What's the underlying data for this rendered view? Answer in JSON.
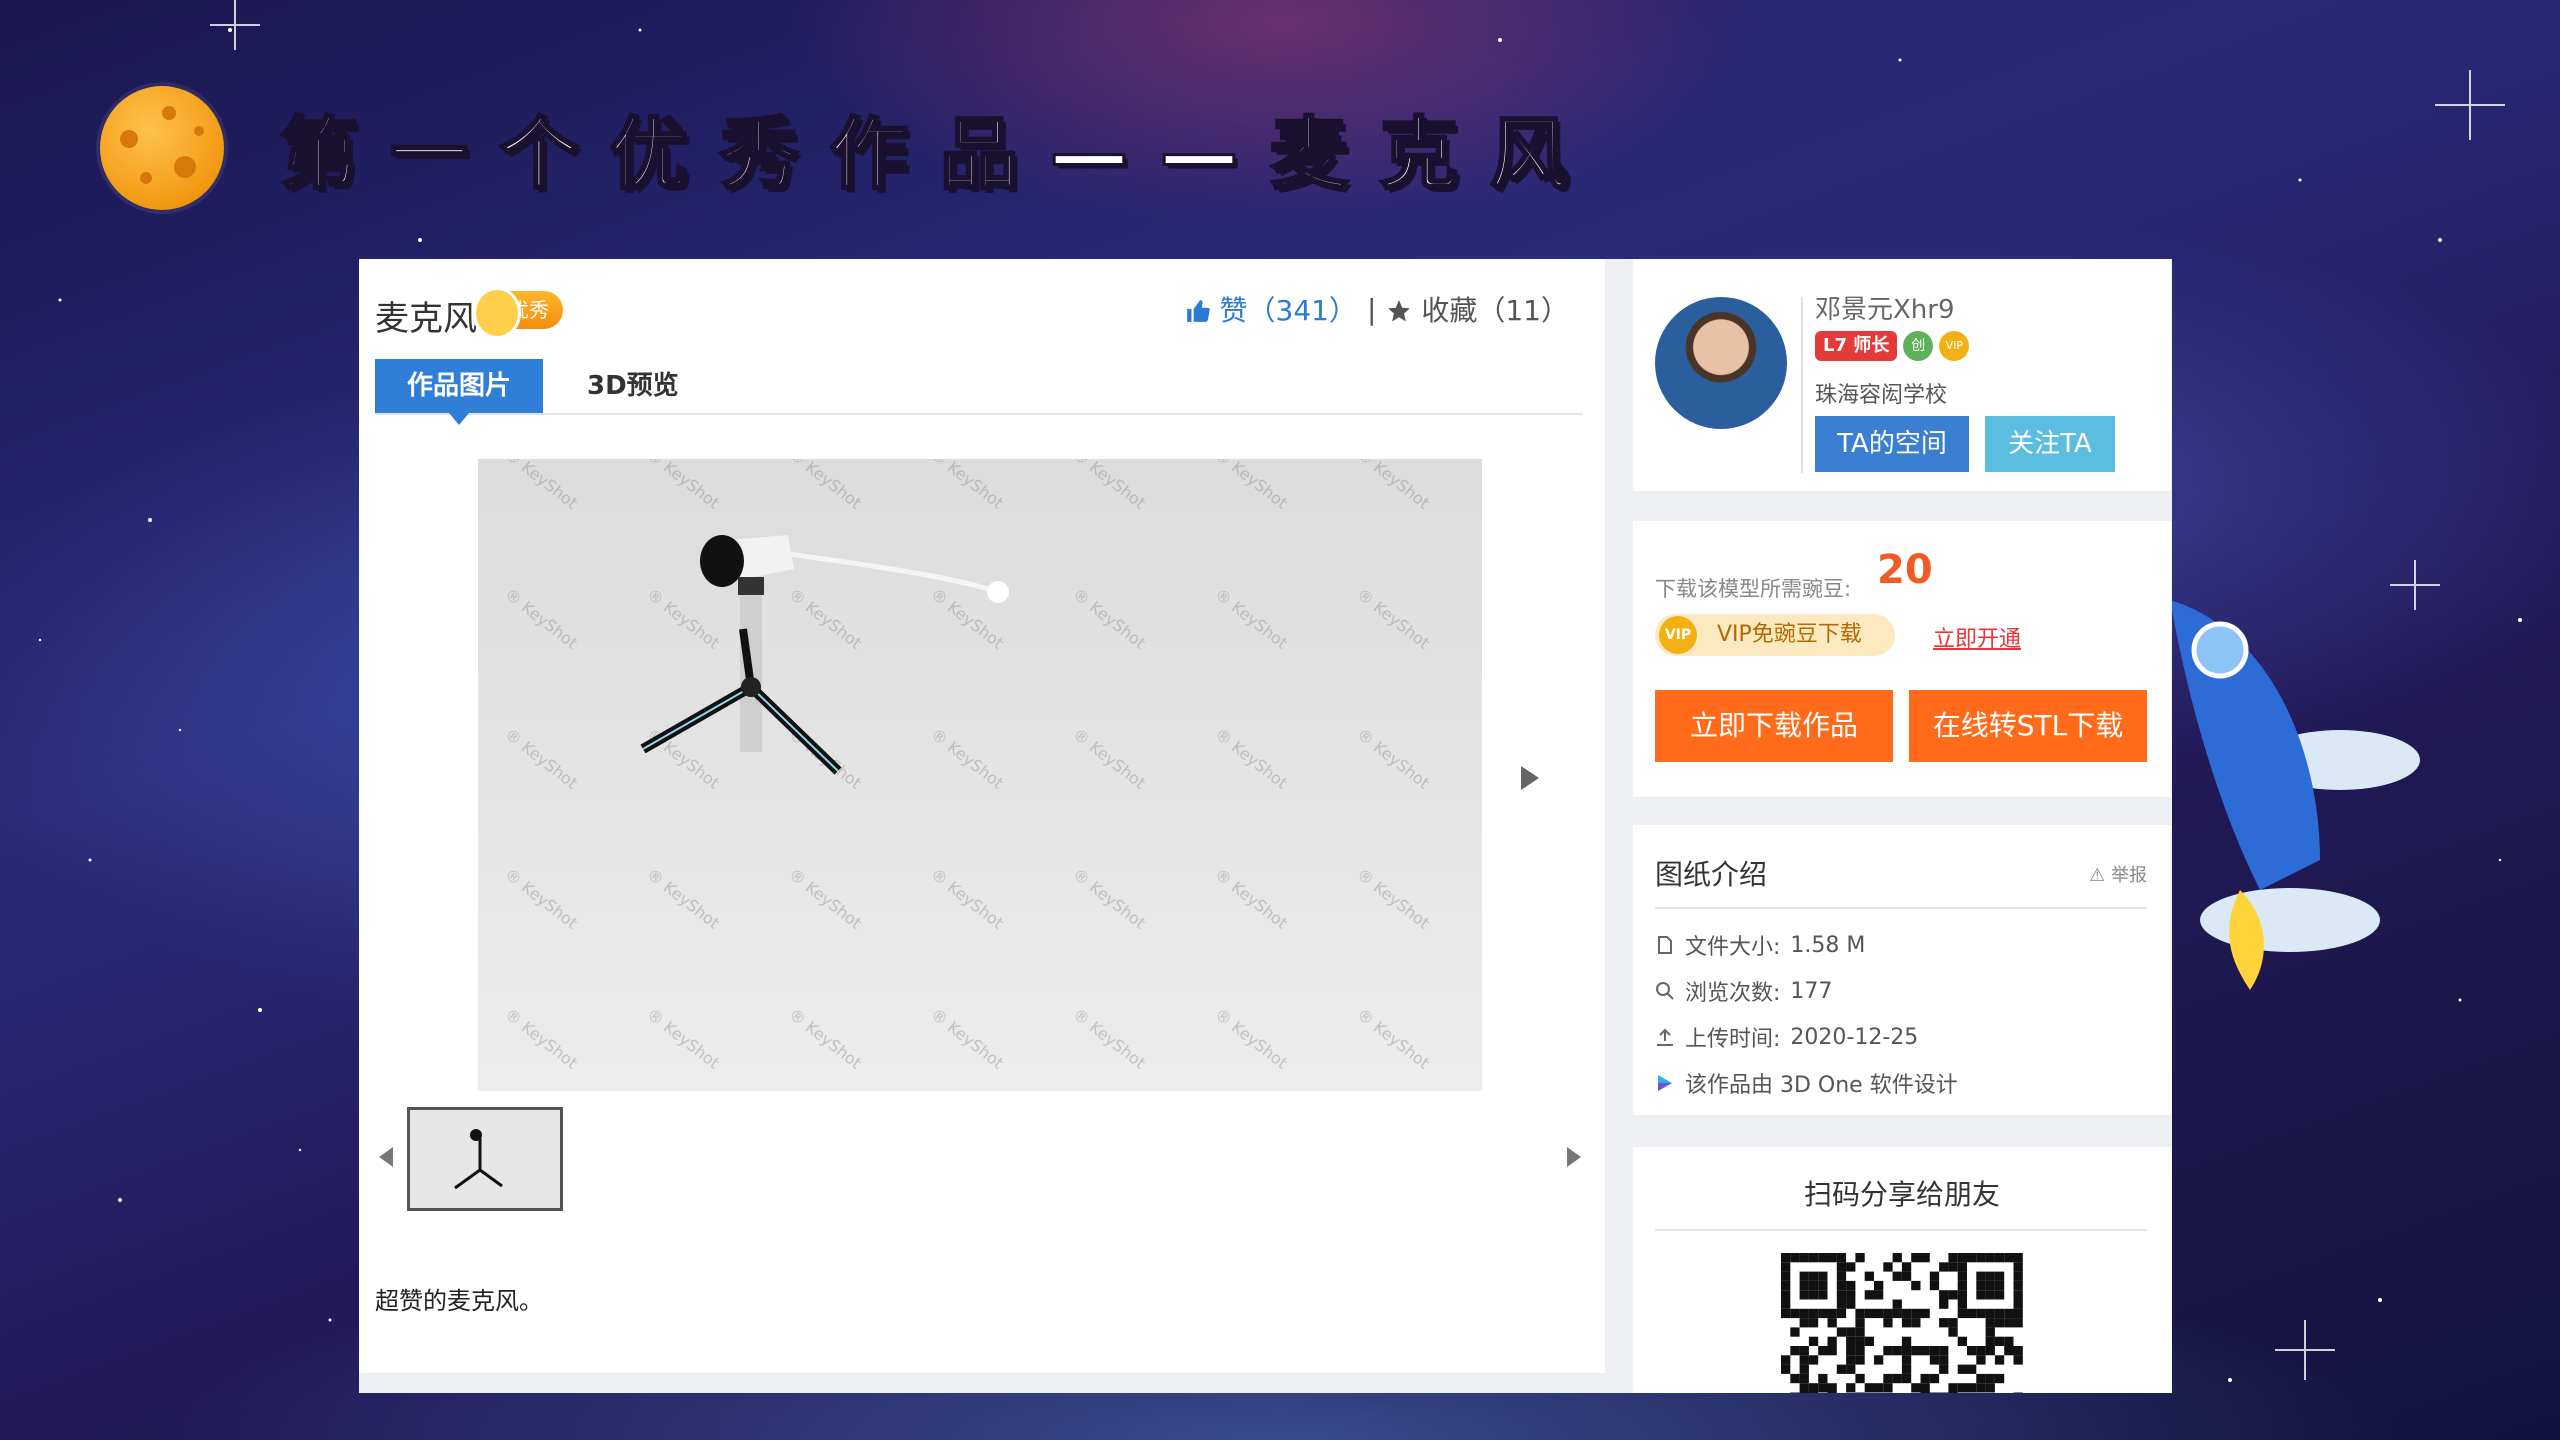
{
  "slide": {
    "title": "第一个优秀作品——麦克风"
  },
  "work": {
    "title": "麦克风",
    "excellent_badge": "优秀",
    "likes_label": "赞",
    "likes_count": "（341）",
    "separator": "|",
    "favorites_label": "收藏",
    "favorites_count": "（11）",
    "tabs": [
      {
        "label": "作品图片",
        "active": true
      },
      {
        "label": "3D预览",
        "active": false
      }
    ],
    "watermark": "KeyShot",
    "description": "超赞的麦克风。"
  },
  "author": {
    "name": "邓景元Xhr9",
    "level_badge": "L7",
    "level_title": "师长",
    "badge_create": "创",
    "badge_vip": "VIP",
    "school": "珠海容闳学校",
    "space_button": "TA的空间",
    "follow_button": "关注TA"
  },
  "download": {
    "cost_label": "下载该模型所需豌豆:",
    "cost_value": "20",
    "vip_icon": "VIP",
    "vip_free": "VIP免豌豆下载",
    "vip_open": "立即开通",
    "download_button": "立即下载作品",
    "stl_button": "在线转STL下载"
  },
  "info": {
    "title": "图纸介绍",
    "report": "举报",
    "rows": [
      {
        "icon": "file-icon",
        "label": "文件大小:",
        "value": "1.58 M"
      },
      {
        "icon": "views-icon",
        "label": "浏览次数:",
        "value": "177"
      },
      {
        "icon": "upload-icon",
        "label": "上传时间:",
        "value": "2020-12-25"
      },
      {
        "icon": "3done-logo-icon",
        "label": "该作品由 3D One 软件设计",
        "value": ""
      }
    ]
  },
  "share": {
    "title": "扫码分享给朋友"
  },
  "colors": {
    "accent_blue": "#2f7fd8",
    "orange": "#ff6b1a",
    "cost_red": "#f15a24"
  }
}
